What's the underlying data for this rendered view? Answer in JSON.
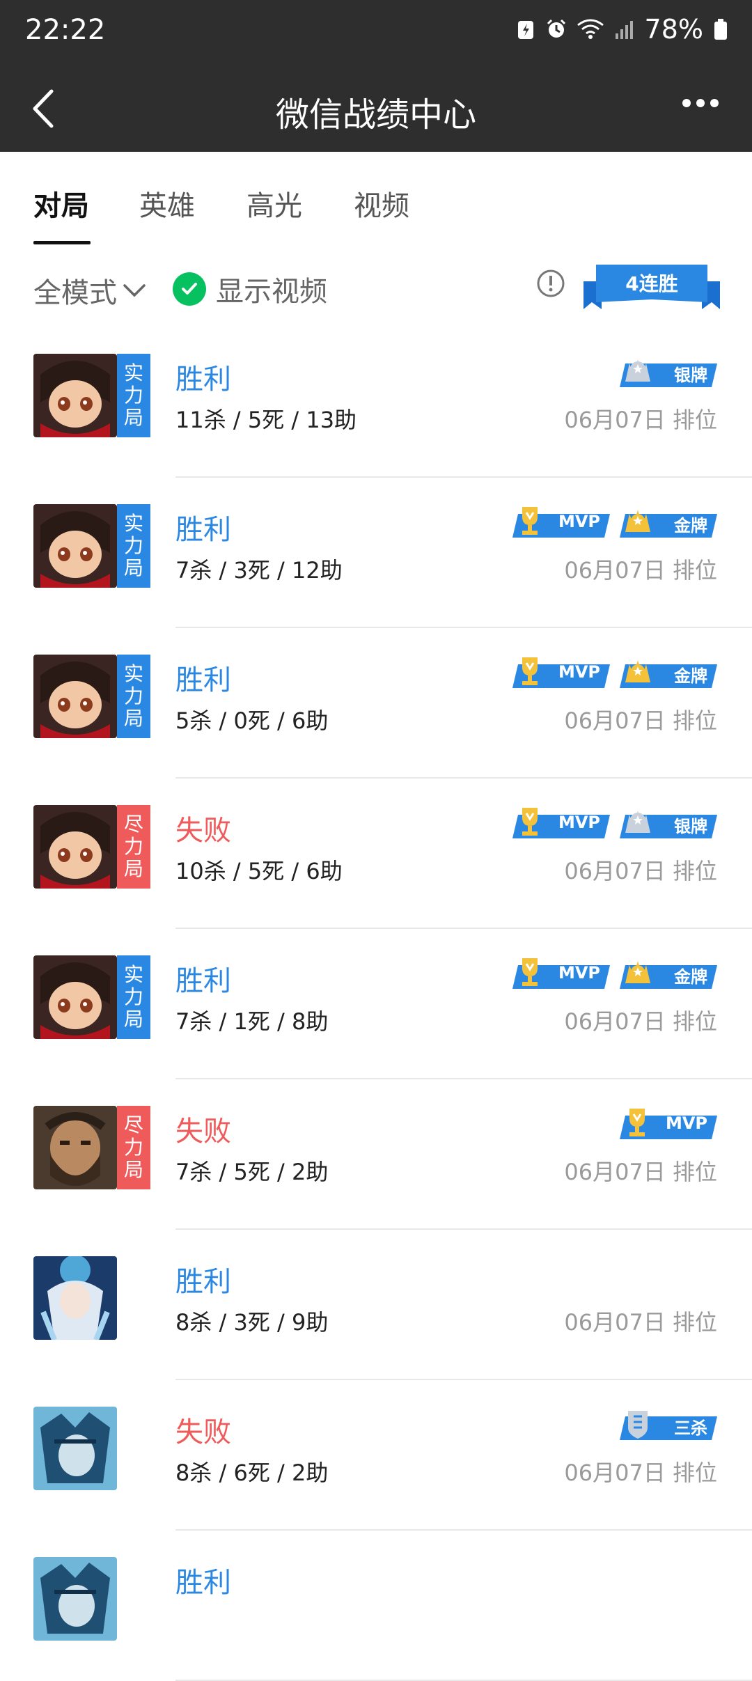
{
  "status": {
    "time": "22:22",
    "battery": "78%"
  },
  "nav": {
    "title": "微信战绩中心"
  },
  "tabs": [
    {
      "label": "对局"
    },
    {
      "label": "英雄"
    },
    {
      "label": "高光"
    },
    {
      "label": "视频"
    }
  ],
  "filters": {
    "mode": "全模式",
    "show_video": "显示视频",
    "streak": "4连胜"
  },
  "colors": {
    "win": "#2b88e2",
    "lose": "#ef5a5a",
    "real_tag": "#2b88e2",
    "effort_tag": "#ef5a5a",
    "check": "#07c160"
  },
  "matches": [
    {
      "result": "胜利",
      "outcome": "win",
      "tag": "实力局",
      "kda": "11杀 / 5死 / 13助",
      "date": "06月07日",
      "mode": "排位",
      "badges": [
        "银牌"
      ],
      "avatar": "hero-a"
    },
    {
      "result": "胜利",
      "outcome": "win",
      "tag": "实力局",
      "kda": "7杀 / 3死 / 12助",
      "date": "06月07日",
      "mode": "排位",
      "badges": [
        "MVP",
        "金牌"
      ],
      "avatar": "hero-a"
    },
    {
      "result": "胜利",
      "outcome": "win",
      "tag": "实力局",
      "kda": "5杀 / 0死 / 6助",
      "date": "06月07日",
      "mode": "排位",
      "badges": [
        "MVP",
        "金牌"
      ],
      "avatar": "hero-a"
    },
    {
      "result": "失败",
      "outcome": "lose",
      "tag": "尽力局",
      "kda": "10杀 / 5死 / 6助",
      "date": "06月07日",
      "mode": "排位",
      "badges": [
        "MVP",
        "银牌"
      ],
      "avatar": "hero-a"
    },
    {
      "result": "胜利",
      "outcome": "win",
      "tag": "实力局",
      "kda": "7杀 / 1死 / 8助",
      "date": "06月07日",
      "mode": "排位",
      "badges": [
        "MVP",
        "金牌"
      ],
      "avatar": "hero-a"
    },
    {
      "result": "失败",
      "outcome": "lose",
      "tag": "尽力局",
      "kda": "7杀 / 5死 / 2助",
      "date": "06月07日",
      "mode": "排位",
      "badges": [
        "MVP"
      ],
      "avatar": "hero-b"
    },
    {
      "result": "胜利",
      "outcome": "win",
      "tag": "",
      "kda": "8杀 / 3死 / 9助",
      "date": "06月07日",
      "mode": "排位",
      "badges": [],
      "avatar": "hero-c"
    },
    {
      "result": "失败",
      "outcome": "lose",
      "tag": "",
      "kda": "8杀 / 6死 / 2助",
      "date": "06月07日",
      "mode": "排位",
      "badges": [
        "三杀"
      ],
      "avatar": "hero-d"
    },
    {
      "result": "胜利",
      "outcome": "win",
      "tag": "",
      "kda": "",
      "date": "",
      "mode": "",
      "badges": [],
      "avatar": "hero-d"
    }
  ]
}
